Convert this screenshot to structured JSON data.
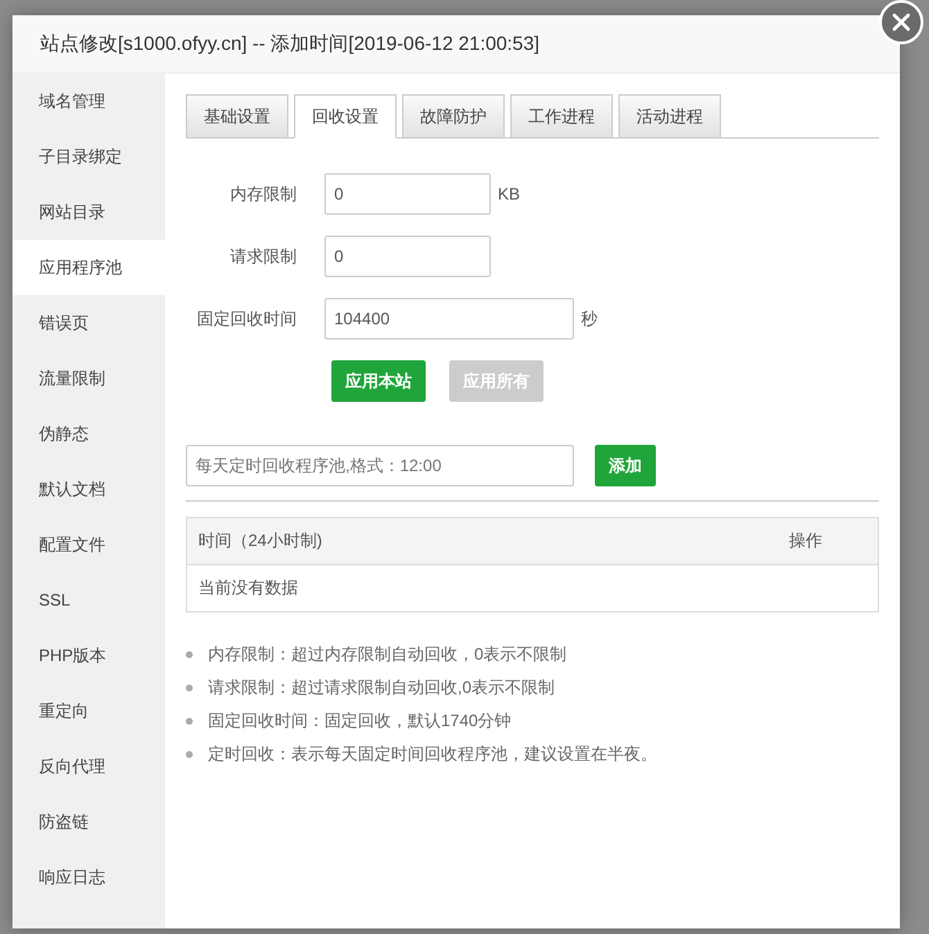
{
  "window": {
    "title": "站点修改[s1000.ofyy.cn] -- 添加时间[2019-06-12 21:00:53]"
  },
  "sidebar": {
    "items": [
      {
        "label": "域名管理",
        "selected": false
      },
      {
        "label": "子目录绑定",
        "selected": false
      },
      {
        "label": "网站目录",
        "selected": false
      },
      {
        "label": "应用程序池",
        "selected": true
      },
      {
        "label": "错误页",
        "selected": false
      },
      {
        "label": "流量限制",
        "selected": false
      },
      {
        "label": "伪静态",
        "selected": false
      },
      {
        "label": "默认文档",
        "selected": false
      },
      {
        "label": "配置文件",
        "selected": false
      },
      {
        "label": "SSL",
        "selected": false
      },
      {
        "label": "PHP版本",
        "selected": false
      },
      {
        "label": "重定向",
        "selected": false
      },
      {
        "label": "反向代理",
        "selected": false
      },
      {
        "label": "防盗链",
        "selected": false
      },
      {
        "label": "响应日志",
        "selected": false
      }
    ]
  },
  "tabs": [
    {
      "label": "基础设置",
      "selected": false
    },
    {
      "label": "回收设置",
      "selected": true
    },
    {
      "label": "故障防护",
      "selected": false
    },
    {
      "label": "工作进程",
      "selected": false
    },
    {
      "label": "活动进程",
      "selected": false
    }
  ],
  "form": {
    "fields": [
      {
        "label": "内存限制",
        "value": "0",
        "unit": "KB",
        "kind": "short"
      },
      {
        "label": "请求限制",
        "value": "0",
        "kind": "short"
      },
      {
        "label": "固定回收时间",
        "value": "104400",
        "unit": "秒",
        "kind": "long"
      }
    ],
    "buttons": [
      {
        "label": "应用本站",
        "disabled": false
      },
      {
        "label": "应用所有",
        "disabled": true
      }
    ]
  },
  "schedule": {
    "placeholder": "每天定时回收程序池,格式：12:00",
    "button": "添加"
  },
  "table": {
    "columns": [
      "时间（24小时制)",
      "操作"
    ],
    "empty": "当前没有数据"
  },
  "notes": [
    "内存限制：超过内存限制自动回收，0表示不限制",
    "请求限制：超过请求限制自动回收,0表示不限制",
    "固定回收时间：固定回收，默认1740分钟",
    "定时回收：表示每天固定时间回收程序池，建议设置在半夜。"
  ]
}
